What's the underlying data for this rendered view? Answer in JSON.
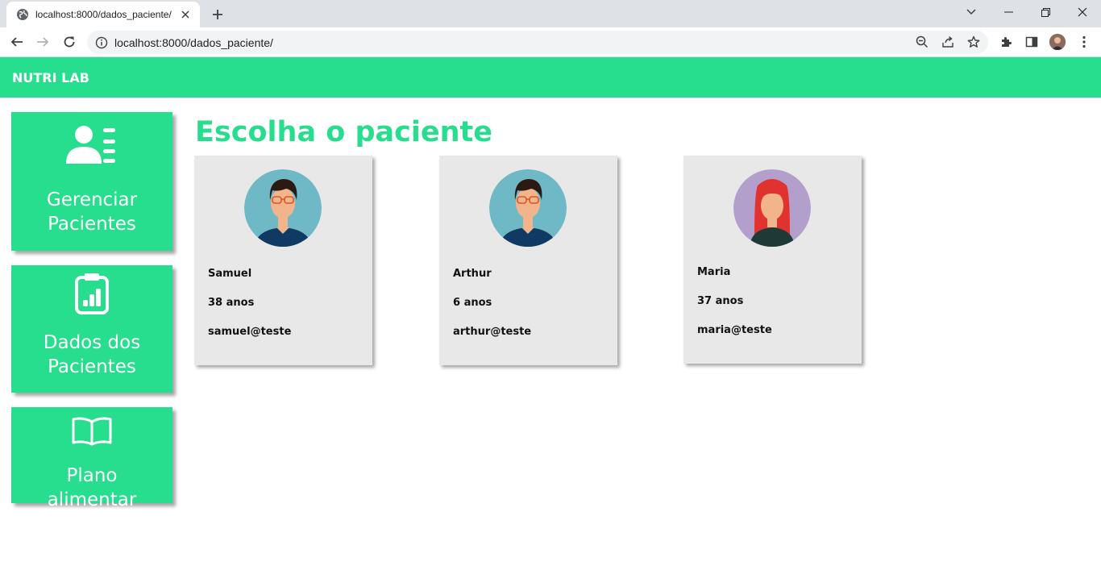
{
  "browser": {
    "tab_title": "localhost:8000/dados_paciente/",
    "url": "localhost:8000/dados_paciente/"
  },
  "app": {
    "brand": "NUTRI LAB",
    "accent_color": "#27de8e"
  },
  "sidebar": {
    "items": [
      {
        "label": "Gerenciar Pacientes",
        "icon": "user-list-icon"
      },
      {
        "label": "Dados dos Pacientes",
        "icon": "clipboard-chart-icon"
      },
      {
        "label": "Plano alimentar",
        "icon": "open-book-icon"
      }
    ]
  },
  "main": {
    "title": "Escolha o paciente",
    "patients": [
      {
        "name": "Samuel",
        "age": "38 anos",
        "email": "samuel@teste",
        "avatar": "male-avatar-icon"
      },
      {
        "name": "Arthur",
        "age": "6 anos",
        "email": "arthur@teste",
        "avatar": "male-avatar-icon"
      },
      {
        "name": "Maria",
        "age": "37 anos",
        "email": "maria@teste",
        "avatar": "female-avatar-icon"
      }
    ]
  }
}
